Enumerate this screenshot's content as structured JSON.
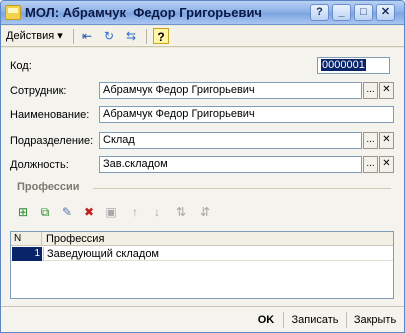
{
  "window": {
    "title": "МОЛ: Абрамчук  Федор Григорьевич"
  },
  "titlebar": {
    "help": "?",
    "minimize": "_",
    "maximize": "□",
    "close": "✕"
  },
  "toolbar": {
    "actions_label": "Действия ▾",
    "help": "?"
  },
  "form": {
    "code": {
      "label": "Код:",
      "value": "0000001"
    },
    "employee": {
      "label": "Сотрудник:",
      "value": "Абрамчук Федор Григорьевич"
    },
    "name": {
      "label": "Наименование:",
      "value": "Абрамчук  Федор Григорьевич"
    },
    "department": {
      "label": "Подразделение:",
      "value": "Склад"
    },
    "position": {
      "label": "Должность:",
      "value": "Зав.складом"
    },
    "select_btn": "...",
    "clear_btn": "✕"
  },
  "professions": {
    "section_title": "Профессии",
    "columns": [
      "N",
      "Профессия"
    ],
    "rows": [
      {
        "n": "1",
        "profession": "Заведующий складом"
      }
    ]
  },
  "buttons": {
    "ok": "OK",
    "save": "Записать",
    "close": "Закрыть"
  }
}
